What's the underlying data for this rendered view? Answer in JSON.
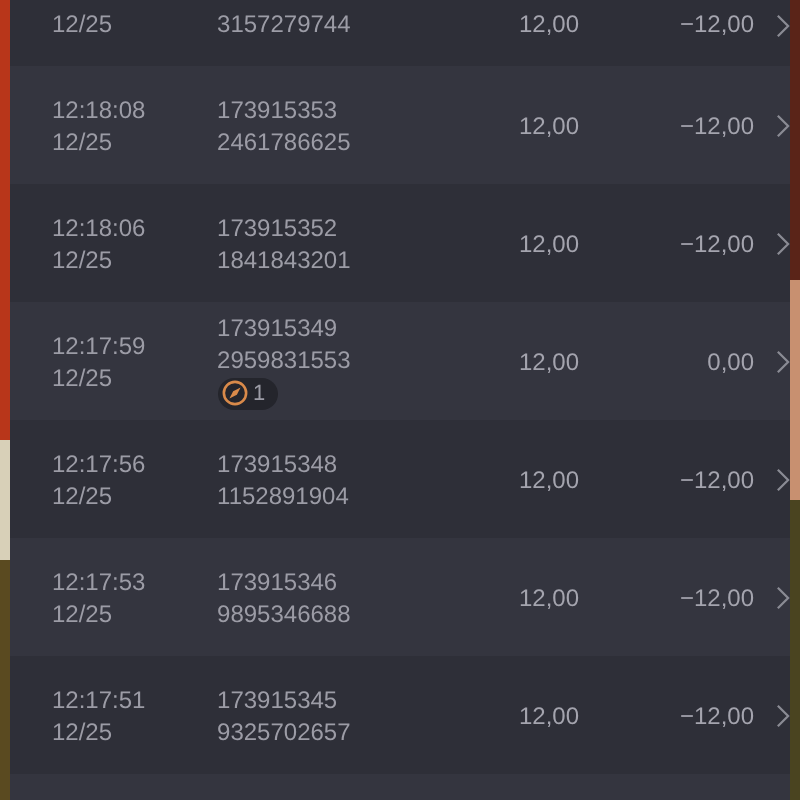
{
  "rows": [
    {
      "date": "12/25",
      "order_id": "3157279744",
      "amount": "12,00",
      "result": "−12,00"
    },
    {
      "time": "12:18:08",
      "date": "12/25",
      "round_id": "173915353",
      "order_id": "2461786625",
      "amount": "12,00",
      "result": "−12,00"
    },
    {
      "time": "12:18:06",
      "date": "12/25",
      "round_id": "173915352",
      "order_id": "1841843201",
      "amount": "12,00",
      "result": "−12,00"
    },
    {
      "time": "12:17:59",
      "date": "12/25",
      "round_id": "173915349",
      "order_id": "2959831553",
      "badge": "1",
      "amount": "12,00",
      "result": "0,00"
    },
    {
      "time": "12:17:56",
      "date": "12/25",
      "round_id": "173915348",
      "order_id": "1152891904",
      "amount": "12,00",
      "result": "−12,00"
    },
    {
      "time": "12:17:53",
      "date": "12/25",
      "round_id": "173915346",
      "order_id": "9895346688",
      "amount": "12,00",
      "result": "−12,00"
    },
    {
      "time": "12:17:51",
      "date": "12/25",
      "round_id": "173915345",
      "order_id": "9325702657",
      "amount": "12,00",
      "result": "−12,00"
    },
    {}
  ]
}
